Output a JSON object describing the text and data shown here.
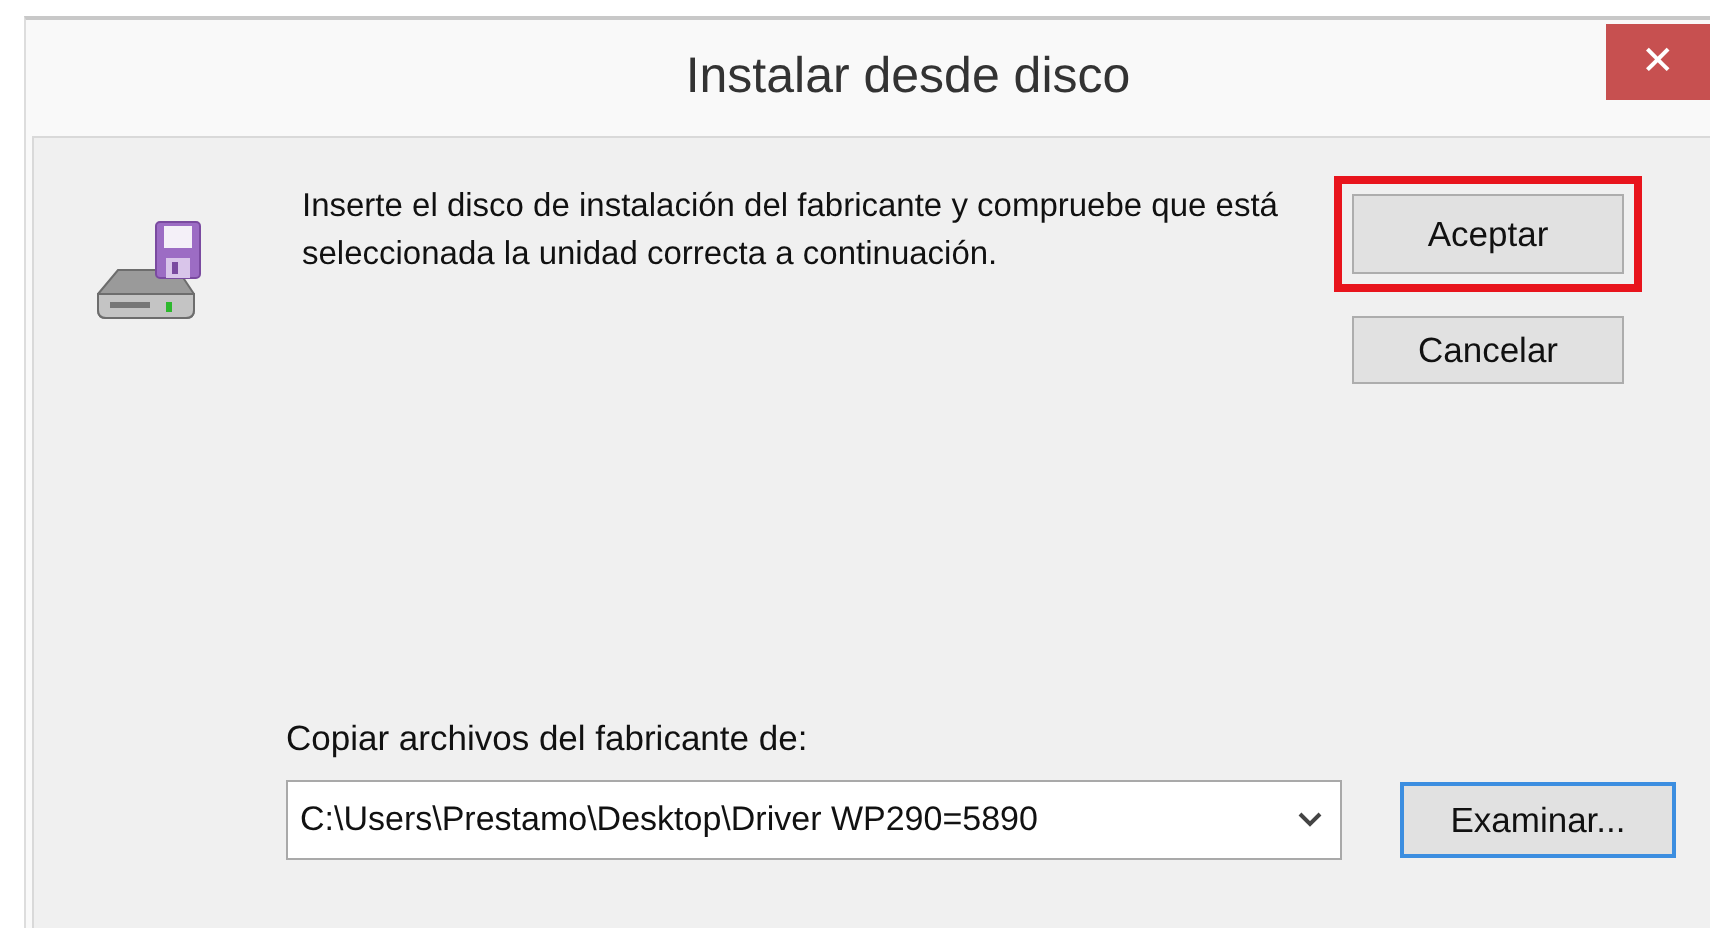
{
  "window": {
    "title": "Instalar desde disco",
    "close": "✕"
  },
  "message": "Inserte el disco de instalación del fabricante y compruebe que está seleccionada la unidad correcta a continuación.",
  "buttons": [
    {
      "label": "Aceptar",
      "highlighted": true
    },
    {
      "label": "Cancelar",
      "highlighted": false
    }
  ],
  "source": {
    "label": "Copiar archivos del fabricante de:",
    "value": "C:\\Users\\Prestamo\\Desktop\\Driver WP290=5890",
    "browse": "Examinar..."
  }
}
